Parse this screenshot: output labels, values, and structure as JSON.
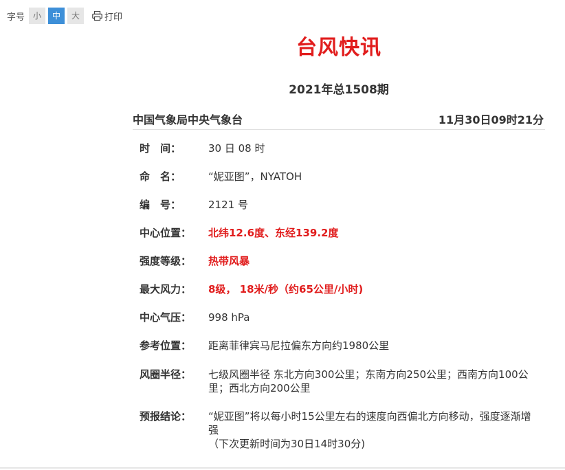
{
  "toolbar": {
    "font_size_label": "字号",
    "small": "小",
    "medium": "中",
    "large": "大",
    "print": "打印"
  },
  "title": "台风快讯",
  "issue": "2021年总1508期",
  "issuer": "中国气象局中央气象台",
  "issue_time": "11月30日09时21分",
  "fields": {
    "time": {
      "label": "时　间：",
      "value": "30 日 08 时"
    },
    "name": {
      "label": "命　名：",
      "value": "“妮亚图”，NYATOH"
    },
    "number": {
      "label": "编　号：",
      "value": "2121 号"
    },
    "center": {
      "label": "中心位置：",
      "value": "北纬12.6度、东经139.2度"
    },
    "intensity": {
      "label": "强度等级：",
      "value": "热带风暴"
    },
    "wind": {
      "label": "最大风力：",
      "value": "8级， 18米/秒（约65公里/小时)"
    },
    "pressure": {
      "label": "中心气压：",
      "value": "998 hPa"
    },
    "reference": {
      "label": "参考位置：",
      "value": "距离菲律宾马尼拉偏东方向约1980公里"
    },
    "radius": {
      "label": "风圈半径：",
      "value": "七级风圈半径 东北方向300公里；东南方向250公里；西南方向100公里；西北方向200公里"
    },
    "forecast": {
      "label": "预报结论：",
      "value": "“妮亚图”将以每小时15公里左右的速度向西偏北方向移动，强度逐渐增强",
      "note": "（下次更新时间为30日14时30分)"
    }
  }
}
